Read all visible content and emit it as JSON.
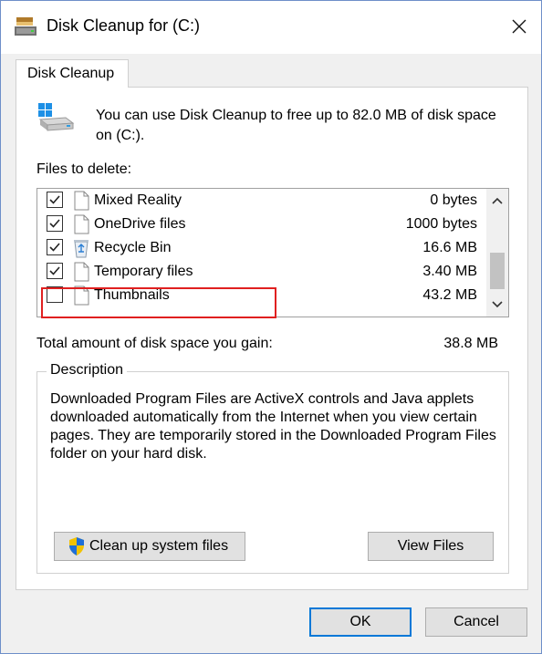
{
  "window": {
    "title": "Disk Cleanup for  (C:)",
    "close_glyph": "✕"
  },
  "tab": {
    "label": "Disk Cleanup"
  },
  "intro": {
    "text": "You can use Disk Cleanup to free up to 82.0 MB of disk space on  (C:)."
  },
  "files": {
    "label": "Files to delete:",
    "items": [
      {
        "name": "Mixed Reality",
        "size": "0 bytes",
        "checked": true,
        "icon": "file-icon"
      },
      {
        "name": "OneDrive files",
        "size": "1000 bytes",
        "checked": true,
        "icon": "file-icon"
      },
      {
        "name": "Recycle Bin",
        "size": "16.6 MB",
        "checked": true,
        "icon": "recycle-bin-icon"
      },
      {
        "name": "Temporary files",
        "size": "3.40 MB",
        "checked": true,
        "icon": "file-icon"
      },
      {
        "name": "Thumbnails",
        "size": "43.2 MB",
        "checked": false,
        "icon": "file-icon"
      }
    ]
  },
  "total": {
    "label": "Total amount of disk space you gain:",
    "value": "38.8 MB"
  },
  "description": {
    "legend": "Description",
    "text": "Downloaded Program Files are ActiveX controls and Java applets downloaded automatically from the Internet when you view certain pages. They are temporarily stored in the Downloaded Program Files folder on your hard disk."
  },
  "buttons": {
    "cleanup_system": "Clean up system files",
    "view_files": "View Files",
    "ok": "OK",
    "cancel": "Cancel"
  },
  "colors": {
    "highlight": "#e02020",
    "window_border": "#6e8fc9",
    "ok_focus": "#0078d7"
  }
}
